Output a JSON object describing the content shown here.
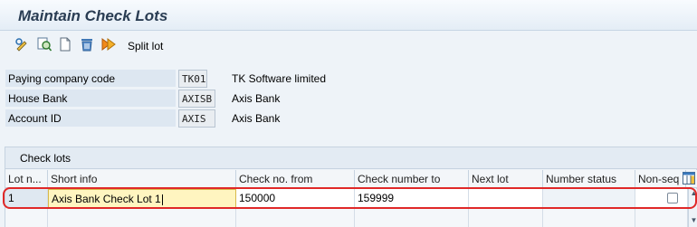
{
  "window": {
    "title": "Maintain Check Lots"
  },
  "toolbar": {
    "icons": [
      "display-change-icon",
      "find-icon",
      "new-entry-icon",
      "delete-icon",
      "execute-icon"
    ],
    "split_lot_label": "Split lot"
  },
  "header_fields": [
    {
      "label": "Paying company code",
      "value": "TK01",
      "description": "TK Software limited"
    },
    {
      "label": "House Bank",
      "value": "AXISB",
      "description": "Axis Bank"
    },
    {
      "label": "Account ID",
      "value": "AXIS",
      "description": "Axis Bank"
    }
  ],
  "check_lots": {
    "title": "Check lots",
    "columns": [
      "Lot n...",
      "Short info",
      "Check no. from",
      "Check number to",
      "Next lot",
      "Number status",
      "Non-seq"
    ],
    "rows": [
      {
        "lot_number": "1",
        "short_info": "Axis Bank Check Lot 1",
        "check_no_from": "150000",
        "check_number_to": "159999",
        "next_lot": "",
        "number_status": "",
        "non_seq": false
      }
    ]
  },
  "colors": {
    "highlight": "#e02828",
    "title": "#2a3d53",
    "focused_cell": "#fff5c0"
  }
}
